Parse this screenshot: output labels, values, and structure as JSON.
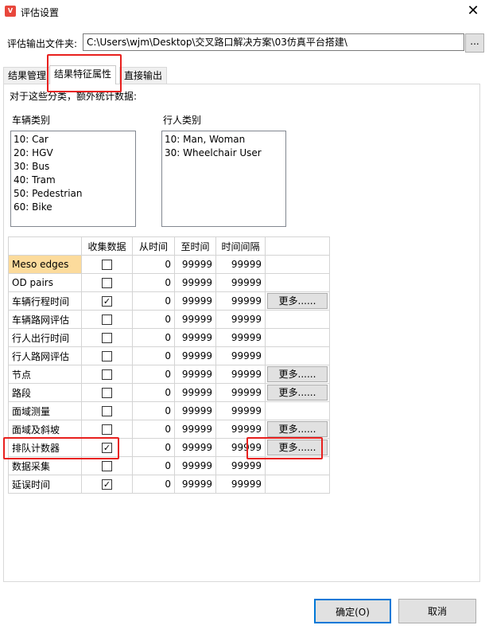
{
  "window": {
    "title": "评估设置",
    "icon": "app-icon"
  },
  "output": {
    "label": "评估输出文件夹:",
    "path": "C:\\Users\\wjm\\Desktop\\交叉路口解决方案\\03仿真平台搭建\\",
    "browse_label": "..."
  },
  "tabs": [
    {
      "label": "结果管理",
      "active": false
    },
    {
      "label": "结果特征属性",
      "active": true
    },
    {
      "label": "直接输出",
      "active": false
    }
  ],
  "hint": "对于这些分类，额外统计数据:",
  "vehicle_classes": {
    "label": "车辆类别",
    "items": [
      "10: Car",
      "20: HGV",
      "30: Bus",
      "40: Tram",
      "50: Pedestrian",
      "60: Bike"
    ]
  },
  "pedestrian_classes": {
    "label": "行人类别",
    "items": [
      "10: Man, Woman",
      "30: Wheelchair User"
    ]
  },
  "grid": {
    "headers": [
      "",
      "收集数据",
      "从时间",
      "至时间",
      "时间间隔",
      ""
    ],
    "rows": [
      {
        "name": "Meso edges",
        "checked": false,
        "from": "0",
        "to": "99999",
        "interval": "99999",
        "more": ""
      },
      {
        "name": "OD pairs",
        "checked": false,
        "from": "0",
        "to": "99999",
        "interval": "99999",
        "more": ""
      },
      {
        "name": "车辆行程时间",
        "checked": true,
        "from": "0",
        "to": "99999",
        "interval": "99999",
        "more": "更多......"
      },
      {
        "name": "车辆路网评估",
        "checked": false,
        "from": "0",
        "to": "99999",
        "interval": "99999",
        "more": ""
      },
      {
        "name": "行人出行时间",
        "checked": false,
        "from": "0",
        "to": "99999",
        "interval": "99999",
        "more": ""
      },
      {
        "name": "行人路网评估",
        "checked": false,
        "from": "0",
        "to": "99999",
        "interval": "99999",
        "more": ""
      },
      {
        "name": "节点",
        "checked": false,
        "from": "0",
        "to": "99999",
        "interval": "99999",
        "more": "更多......"
      },
      {
        "name": "路段",
        "checked": false,
        "from": "0",
        "to": "99999",
        "interval": "99999",
        "more": "更多......"
      },
      {
        "name": "面域测量",
        "checked": false,
        "from": "0",
        "to": "99999",
        "interval": "99999",
        "more": ""
      },
      {
        "name": "面域及斜坡",
        "checked": false,
        "from": "0",
        "to": "99999",
        "interval": "99999",
        "more": "更多......"
      },
      {
        "name": "排队计数器",
        "checked": true,
        "from": "0",
        "to": "99999",
        "interval": "99999",
        "more": "更多......"
      },
      {
        "name": "数据采集",
        "checked": false,
        "from": "0",
        "to": "99999",
        "interval": "99999",
        "more": ""
      },
      {
        "name": "延误时间",
        "checked": true,
        "from": "0",
        "to": "99999",
        "interval": "99999",
        "more": ""
      }
    ]
  },
  "buttons": {
    "ok": "确定(O)",
    "cancel": "取消"
  },
  "colors": {
    "highlight_cell": "#fcdb9c",
    "annotation_red": "#e8201e",
    "focus_blue": "#0078d7"
  }
}
